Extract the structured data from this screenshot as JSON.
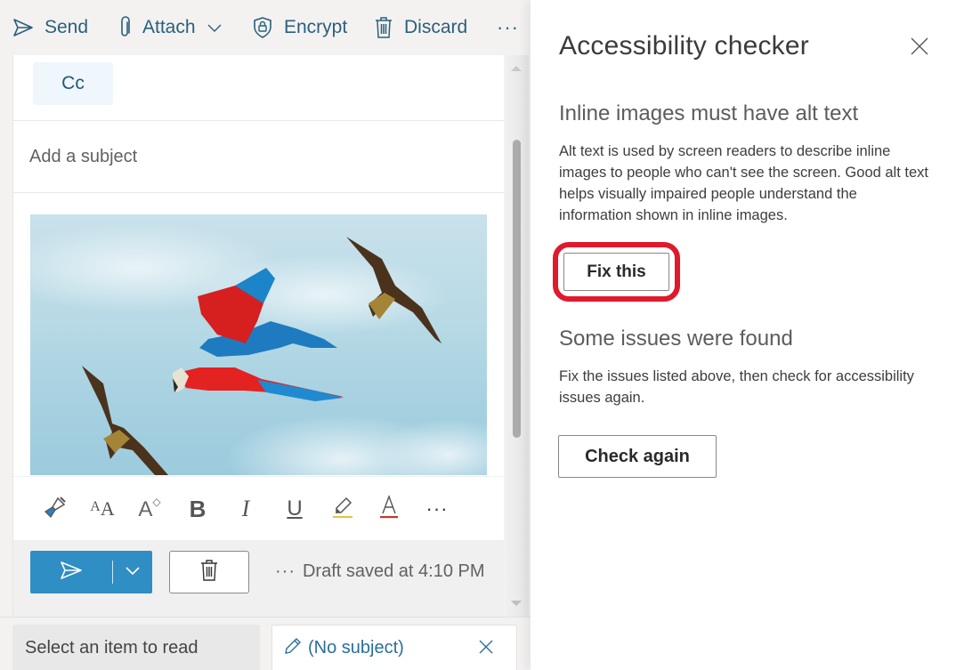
{
  "toolbar": {
    "send": {
      "label": "Send",
      "icon": "send-icon"
    },
    "attach": {
      "label": "Attach",
      "icon": "paperclip-icon"
    },
    "encrypt": {
      "label": "Encrypt",
      "icon": "shield-lock-icon"
    },
    "discard": {
      "label": "Discard",
      "icon": "trash-icon"
    },
    "more": "···"
  },
  "compose": {
    "cc_label": "Cc",
    "subject_placeholder": "Add a subject",
    "subject_value": "",
    "image": {
      "description": "scarlet macaw flying between two kites against a blue sky",
      "alt_text": ""
    },
    "format_toolbar": [
      {
        "name": "format-painter",
        "icon": "paintbrush-icon"
      },
      {
        "name": "font-size",
        "icon": "font-size-icon"
      },
      {
        "name": "grow-font",
        "icon": "increase-font-icon"
      },
      {
        "name": "bold",
        "icon": "bold-icon"
      },
      {
        "name": "italic",
        "icon": "italic-icon"
      },
      {
        "name": "underline",
        "icon": "underline-icon"
      },
      {
        "name": "highlight",
        "icon": "highlighter-icon"
      },
      {
        "name": "font-color",
        "icon": "font-color-icon"
      },
      {
        "name": "more-formatting",
        "icon": "more-icon"
      }
    ],
    "draft_status_dots": "···",
    "draft_status": "Draft saved at 4:10 PM"
  },
  "bottom_tabs": {
    "read": "Select an item to read",
    "draft": "(No subject)"
  },
  "panel": {
    "title": "Accessibility checker",
    "issue_title": "Inline images must have alt text",
    "issue_description": "Alt text is used by screen readers to describe inline images to people who can't see the screen. Good alt text helps visually impaired people understand the information shown in inline images.",
    "fix_button": "Fix this",
    "status_title": "Some issues were found",
    "status_description": "Fix the issues listed above, then check for accessibility issues again.",
    "check_button": "Check again"
  },
  "colors": {
    "accent": "#2f8ec4",
    "link": "#2b6f9a",
    "highlight_ring": "#e0192b",
    "toolbar_text": "#2b5f7e"
  }
}
